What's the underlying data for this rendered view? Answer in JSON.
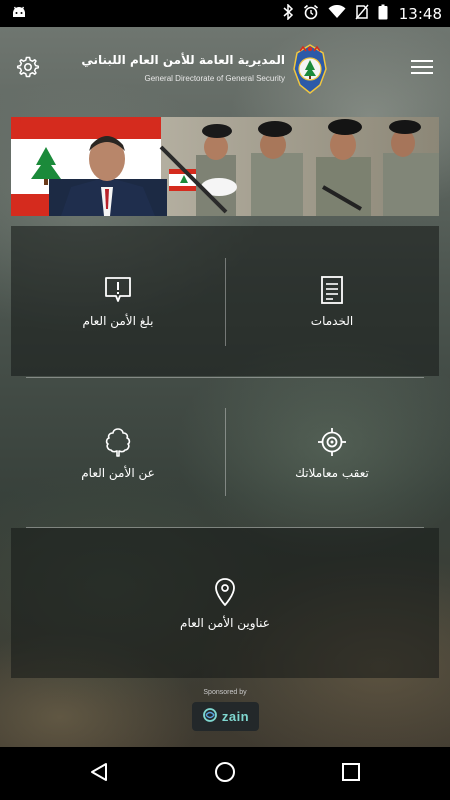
{
  "status_bar": {
    "time": "13:48",
    "icons": [
      "android-icon",
      "bluetooth-icon",
      "alarm-icon",
      "wifi-icon",
      "no-sim-icon",
      "battery-icon"
    ]
  },
  "header": {
    "title_ar": "المديرية العامة للأمن العام اللبناني",
    "title_en": "General Directorate of General Security",
    "settings_icon": "gear-icon",
    "menu_icon": "hamburger-icon"
  },
  "banner": {
    "description_icon": "banner-photo"
  },
  "tiles": [
    {
      "id": "report",
      "label": "بلغ الأمن العام",
      "icon": "report-alert-icon"
    },
    {
      "id": "services",
      "label": "الخدمات",
      "icon": "document-list-icon"
    },
    {
      "id": "about",
      "label": "عن الأمن العام",
      "icon": "cedar-tree-icon"
    },
    {
      "id": "track",
      "label": "تعقب معاملاتك",
      "icon": "target-icon"
    },
    {
      "id": "addresses",
      "label": "عناوين الأمن العام",
      "icon": "location-pin-icon"
    }
  ],
  "sponsor": {
    "label": "Sponsored by",
    "brand": "zain"
  },
  "colors": {
    "status_bar": "#000000",
    "nav_bar": "#000000",
    "zain_teal": "#7fd7d0",
    "flag_red": "#d52b1e",
    "cedar_green": "#1b8a3a"
  }
}
